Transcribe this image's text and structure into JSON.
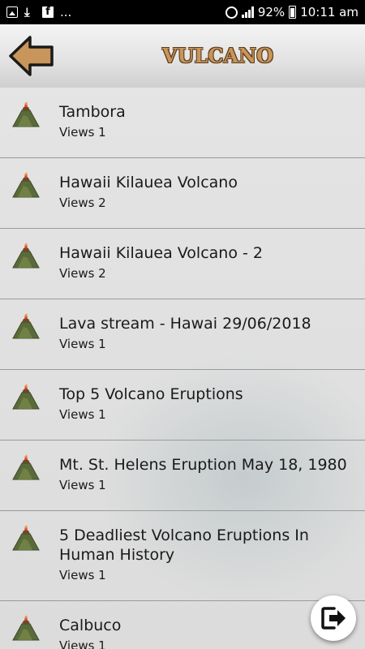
{
  "status_bar": {
    "notification_icons": [
      "image-icon",
      "download-icon",
      "facebook-icon"
    ],
    "overflow": "...",
    "alarm_icon": "alarm-icon",
    "signal_icon": "signal-icon",
    "battery": "92%",
    "time": "10:11 am"
  },
  "header": {
    "title": "VULCANO",
    "back_icon": "arrow-left-icon",
    "colors": {
      "title": "#c8955a",
      "title_outline": "#5a3a1a",
      "arrow": "#c8955a"
    }
  },
  "list": {
    "items": [
      {
        "title": "Tambora",
        "views": "Views 1"
      },
      {
        "title": "Hawaii Kilauea Volcano",
        "views": "Views 2"
      },
      {
        "title": "Hawaii Kilauea Volcano - 2",
        "views": "Views 2"
      },
      {
        "title": "Lava stream - Hawai 29/06/2018",
        "views": "Views 1"
      },
      {
        "title": "Top 5 Volcano Eruptions",
        "views": "Views 1"
      },
      {
        "title": "Mt. St. Helens Eruption May 18, 1980",
        "views": "Views 1"
      },
      {
        "title": "5 Deadliest Volcano Eruptions In Human History",
        "views": "Views 1"
      },
      {
        "title": "Calbuco",
        "views": "Views 1"
      }
    ]
  },
  "exit_button": {
    "icon": "exit-icon"
  }
}
